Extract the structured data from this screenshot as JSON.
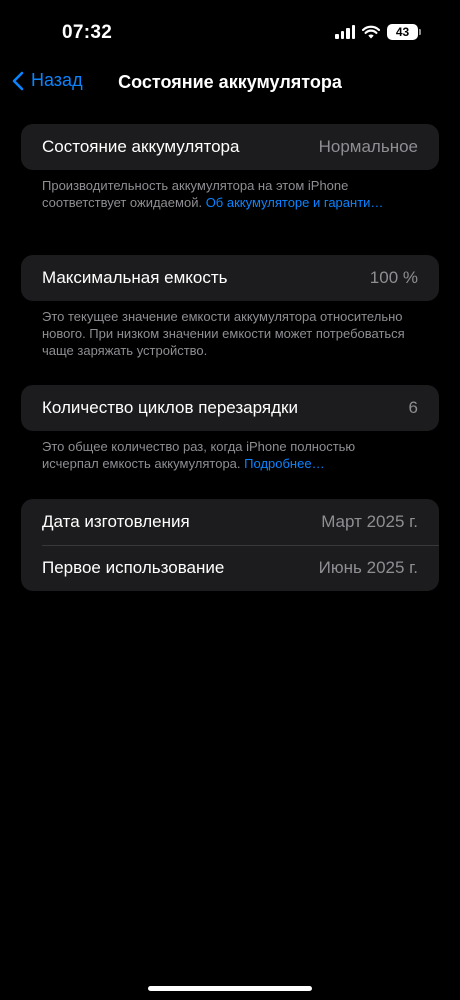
{
  "status_bar": {
    "time": "07:32",
    "battery_level": "43",
    "icons": [
      "signal-icon",
      "wifi-icon",
      "battery-icon"
    ]
  },
  "nav": {
    "back_label": "Назад",
    "title": "Состояние аккумулятора"
  },
  "sections": {
    "health": {
      "label": "Состояние аккумулятора",
      "value": "Нормальное",
      "footnote": "Производительность аккумулятора на этом iPhone соответствует ожидаемой.",
      "link": "Об аккумуляторе и гаранти…"
    },
    "capacity": {
      "label": "Максимальная емкость",
      "value": "100 %",
      "footnote": "Это текущее значение емкости аккумулятора относительно нового. При низком значении емкости может потребоваться чаще заряжать устройство."
    },
    "cycles": {
      "label": "Количество циклов перезарядки",
      "value": "6",
      "footnote": "Это общее количество раз, когда iPhone полностью исчерпал емкость аккумулятора.",
      "link": "Подробнее…"
    },
    "dates": {
      "manufacture_label": "Дата изготовления",
      "manufacture_value": "Март 2025 г.",
      "first_use_label": "Первое использование",
      "first_use_value": "Июнь 2025 г."
    }
  },
  "colors": {
    "accent": "#0a84ff",
    "cell_background": "#1c1c1e",
    "secondary_text": "#8e8e93",
    "background": "#000000"
  }
}
